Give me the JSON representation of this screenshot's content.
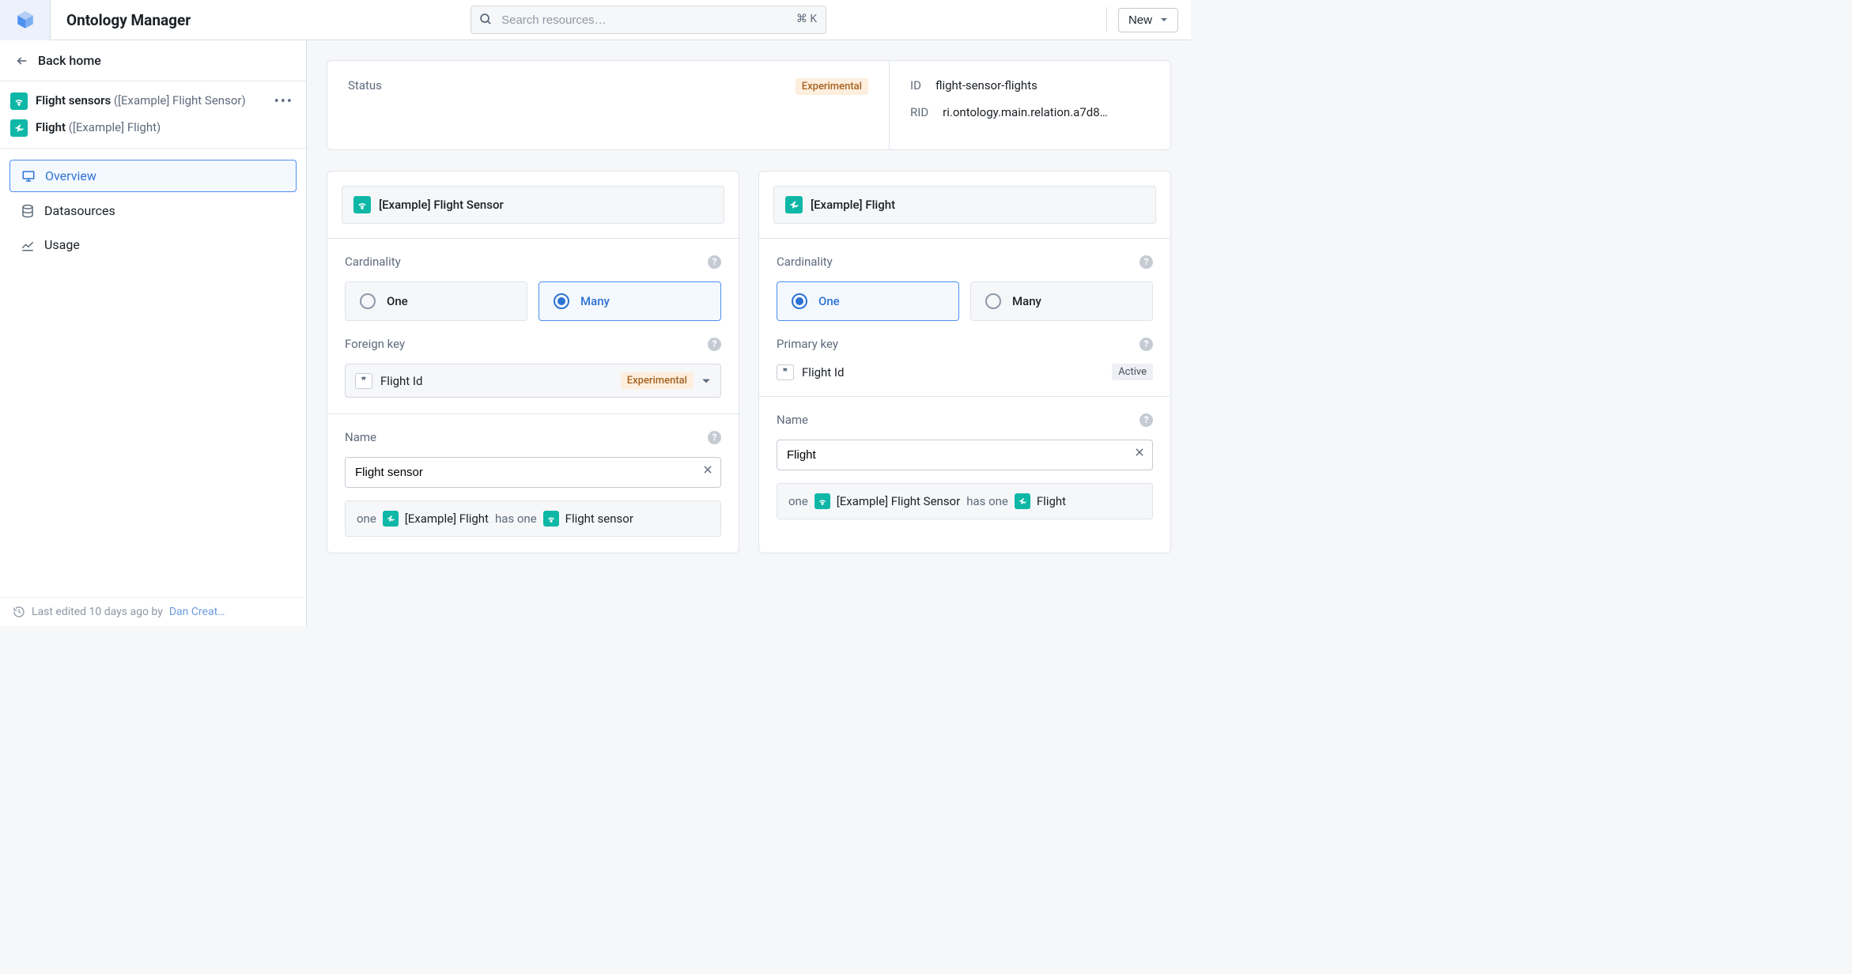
{
  "app_title": "Ontology Manager",
  "search": {
    "placeholder": "Search resources…",
    "shortcut": "⌘ K"
  },
  "new_button": "New",
  "sidebar": {
    "back": "Back home",
    "crumbs": [
      {
        "primary": "Flight sensors ",
        "secondary": "([Example] Flight Sensor)",
        "icon": "sensor"
      },
      {
        "primary": "Flight ",
        "secondary": "([Example] Flight)",
        "icon": "flight"
      }
    ],
    "nav": [
      {
        "label": "Overview",
        "icon": "monitor",
        "active": true
      },
      {
        "label": "Datasources",
        "icon": "database",
        "active": false
      },
      {
        "label": "Usage",
        "icon": "chart",
        "active": false
      }
    ],
    "footer_prefix": "Last edited 10 days ago by ",
    "footer_user": "Dan Creat…"
  },
  "status": {
    "label": "Status",
    "badge": "Experimental",
    "id": {
      "label": "ID",
      "value": "flight-sensor-flights"
    },
    "rid": {
      "label": "RID",
      "value": "ri.ontology.main.relation.a7d8…"
    }
  },
  "left": {
    "header": "[Example] Flight Sensor",
    "cardinality": {
      "label": "Cardinality",
      "options": [
        "One",
        "Many"
      ],
      "selected": "Many"
    },
    "foreign_key": {
      "label": "Foreign key",
      "value": "Flight Id",
      "badge": "Experimental"
    },
    "name": {
      "label": "Name",
      "value": "Flight sensor"
    },
    "sentence": {
      "parts": [
        {
          "t": "text",
          "v": "one"
        },
        {
          "t": "chip",
          "icon": "flight"
        },
        {
          "t": "obj",
          "v": "[Example] Flight"
        },
        {
          "t": "text",
          "v": " has one"
        },
        {
          "t": "chip",
          "icon": "sensor"
        },
        {
          "t": "obj",
          "v": "Flight sensor"
        }
      ]
    }
  },
  "right": {
    "header": "[Example] Flight",
    "cardinality": {
      "label": "Cardinality",
      "options": [
        "One",
        "Many"
      ],
      "selected": "One"
    },
    "primary_key": {
      "label": "Primary key",
      "value": "Flight Id",
      "badge": "Active"
    },
    "name": {
      "label": "Name",
      "value": "Flight"
    },
    "sentence": {
      "parts": [
        {
          "t": "text",
          "v": "one"
        },
        {
          "t": "chip",
          "icon": "sensor"
        },
        {
          "t": "obj",
          "v": "[Example] Flight Sensor"
        },
        {
          "t": "text",
          "v": " has one"
        },
        {
          "t": "chip",
          "icon": "flight"
        },
        {
          "t": "obj",
          "v": "Flight"
        }
      ]
    }
  }
}
